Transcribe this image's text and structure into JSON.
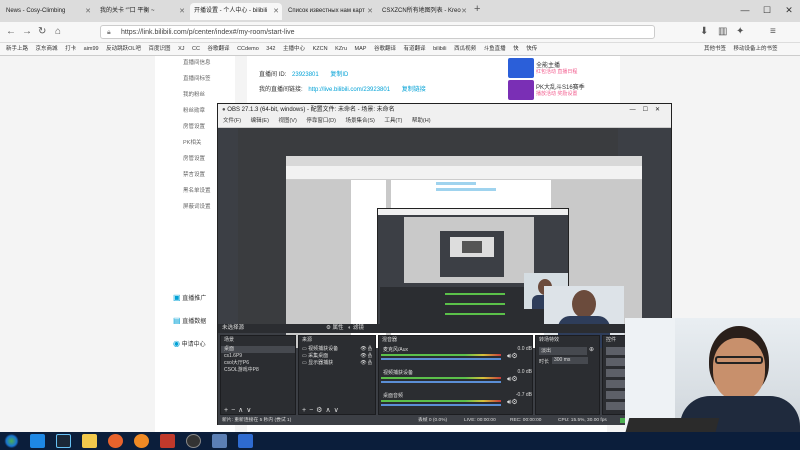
{
  "browser": {
    "tabs": [
      {
        "label": "News - Cosy-Climbing",
        "active": false
      },
      {
        "label": "我的关卡 “”口 平衡 ~",
        "active": false
      },
      {
        "label": "开播设置 - 个人中心 - bilibili",
        "active": true
      },
      {
        "label": "Список известных нам карт",
        "active": false
      },
      {
        "label": "CSXZCN所有地图列表 - Kreo",
        "active": false
      }
    ],
    "url": "https://link.bilibili.com/p/center/index#/my-room/start-live",
    "bookmarks": [
      "新手上路",
      "京东商城",
      "打卡",
      "aim99",
      "反动跳跃OL吧",
      "百度识图",
      "XJ",
      "CC",
      "谷歌翻译",
      "CCdemo",
      "342",
      "主播中心",
      "KZCN",
      "KZru",
      "MAP",
      "谷歌翻译",
      "有道翻译",
      "bilibili",
      "西瓜视频",
      "斗鱼直播",
      "快",
      "快传"
    ],
    "bookmarks_right": [
      "其他书签",
      "移动设备上的书签"
    ]
  },
  "bili": {
    "sidebar_items": [
      "直播间信息",
      "直播间标签",
      "我的粉丝",
      "粉丝勋章",
      "房管设置",
      "PK相关",
      "房管设置",
      "禁言设置",
      "黑名单设置",
      "屏蔽词设置"
    ],
    "sidebar_bottom": [
      "直播推广",
      "直播数据",
      "申请中心"
    ],
    "room_id_label": "直播间 ID:",
    "room_id": "23923801",
    "copy_label": "复制ID",
    "room_link_label": "我的直播间链接:",
    "room_link": "http://live.bilibili.com/23923801",
    "copy_link": "复制链接",
    "promo1_title": "全能主播",
    "promo1_links": [
      "红包活动",
      "直播日程"
    ],
    "promo2_title": "PK大乱斗S16赛季",
    "promo2_links": [
      "播放活动",
      "奖励设置"
    ]
  },
  "obs": {
    "title": "OBS 27.1.3 (64-bit, windows) - 配置文件: 未命名 - 场景: 未命名",
    "menu": [
      "文件(F)",
      "编辑(E)",
      "视图(V)",
      "停靠窗口(D)",
      "场景集合(S)",
      "工具(T)",
      "帮助(H)"
    ],
    "source_label": "未选择源",
    "props_button": "属性",
    "filters_button": "滤镜",
    "panels": {
      "scenes": "场景",
      "sources": "来源",
      "mixer": "混音器",
      "transitions": "转场特效",
      "controls": "控件"
    },
    "scenes": [
      "桌面",
      "cs1.6P9",
      "csol大厅P6",
      "CSOL游戏中P8"
    ],
    "sources": [
      "视频捕获设备",
      "采集桌面",
      "显示器捕获"
    ],
    "mixer": [
      {
        "name": "麦克风/Aux",
        "db": "0.0 dB"
      },
      {
        "name": "视频捕获设备",
        "db": "0.0 dB"
      },
      {
        "name": "桌面音频",
        "db": "-0.7 dB"
      }
    ],
    "transition": "淡出",
    "duration_label": "时长",
    "duration": "300 ms",
    "status": {
      "scene_info": "新片: 重新连接在 5 秒内 (尝试 1)",
      "dropped": "丢帧 0 (0.0%)",
      "live": "LIVE: 00:00:00",
      "rec": "REC: 00:00:00",
      "cpu": "CPU: 15.5%, 30.00 fps"
    }
  },
  "taskbar": {
    "apps": [
      "start",
      "ie",
      "steam",
      "explorer",
      "firefox",
      "firefox2",
      "cs",
      "obs",
      "media",
      "kz"
    ]
  },
  "colors": {
    "bili_blue": "#00a1d6",
    "obs_bg": "#3c3f45",
    "taskbar": "#0b1e3b"
  }
}
